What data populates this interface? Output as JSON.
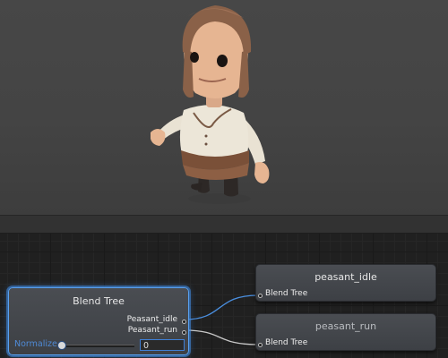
{
  "blend_tree_node": {
    "title": "Blend Tree",
    "outputs": [
      "Peasant_idle",
      "Peasant_run"
    ],
    "parameter_label": "Normalize",
    "parameter_value": "0",
    "slider_fraction": 0
  },
  "motion_nodes": [
    {
      "title": "peasant_idle",
      "input_label": "Blend Tree",
      "dimmed": false
    },
    {
      "title": "peasant_run",
      "input_label": "Blend Tree",
      "dimmed": true
    }
  ],
  "colors": {
    "selection_outline": "#5aa0ee",
    "parameter_text": "#4f8ad6",
    "connection_line": "#4a8fe0"
  }
}
